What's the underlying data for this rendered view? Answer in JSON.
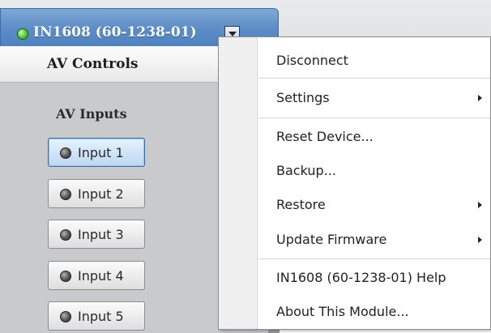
{
  "device_tab": {
    "title": "IN1608 (60-1238-01)",
    "status": "connected",
    "status_color": "#4caf2a",
    "tab_color": "#5b8cc6"
  },
  "av_panel": {
    "header": "AV Controls",
    "inputs_title": "AV Inputs",
    "inputs": [
      {
        "label": "Input 1",
        "selected": true
      },
      {
        "label": "Input 2",
        "selected": false
      },
      {
        "label": "Input 3",
        "selected": false
      },
      {
        "label": "Input 4",
        "selected": false
      },
      {
        "label": "Input 5",
        "selected": false
      }
    ]
  },
  "context_menu": {
    "items": [
      {
        "label": "Disconnect",
        "submenu": false
      },
      {
        "label": "Settings",
        "submenu": true
      },
      {
        "label": "Reset Device...",
        "submenu": false
      },
      {
        "label": "Backup...",
        "submenu": false
      },
      {
        "label": "Restore",
        "submenu": true
      },
      {
        "label": "Update Firmware",
        "submenu": true
      },
      {
        "label": "IN1608 (60-1238-01) Help",
        "submenu": false
      },
      {
        "label": "About This Module...",
        "submenu": false
      }
    ]
  }
}
